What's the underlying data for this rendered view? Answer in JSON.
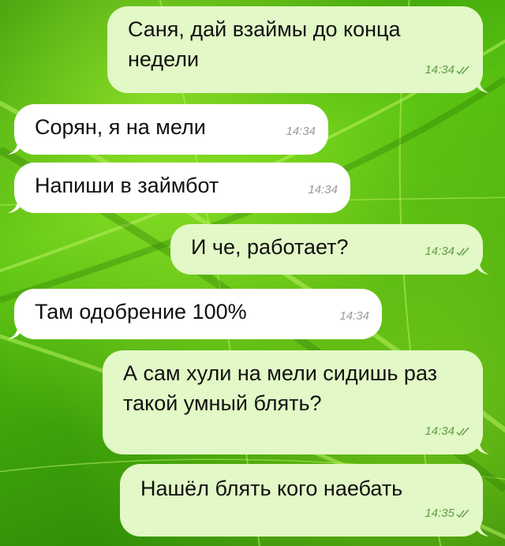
{
  "messages": [
    {
      "text": "Саня, дай взаймы до конца недели",
      "time": "14:34",
      "outgoing": true,
      "read": true
    },
    {
      "text": "Сорян, я на мели",
      "time": "14:34",
      "outgoing": false
    },
    {
      "text": "Напиши в займбот",
      "time": "14:34",
      "outgoing": false
    },
    {
      "text": "И че, работает?",
      "time": "14:34",
      "outgoing": true,
      "read": true
    },
    {
      "text": "Там одобрение 100%",
      "time": "14:34",
      "outgoing": false
    },
    {
      "text": "А сам хули на мели сидишь раз такой умный блять?",
      "time": "14:34",
      "outgoing": true,
      "read": true
    },
    {
      "text": "Нашёл блять кого наебать",
      "time": "14:35",
      "outgoing": true,
      "read": true
    }
  ],
  "colors": {
    "outgoing_bubble": "#e2f8c6",
    "incoming_bubble": "#ffffff",
    "outgoing_meta": "#5f9d45",
    "incoming_meta": "#9a9a9a"
  },
  "icons": {
    "read_receipt": "double-check-icon",
    "wallpaper": "green-leaf-wallpaper"
  }
}
